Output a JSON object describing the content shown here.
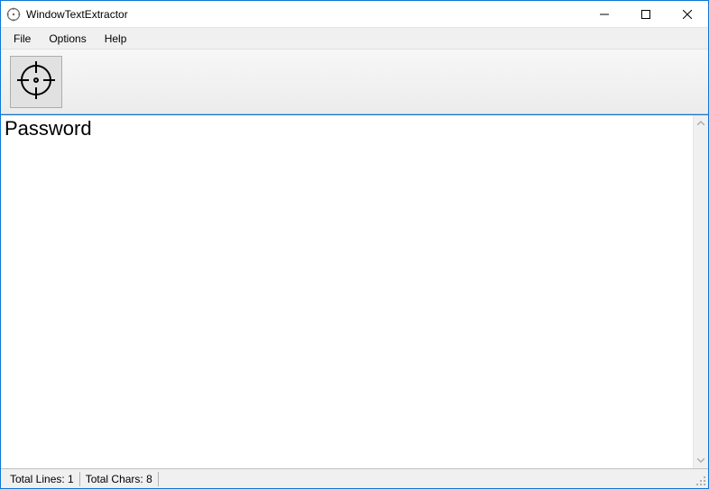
{
  "titlebar": {
    "title": "WindowTextExtractor"
  },
  "menubar": {
    "items": [
      {
        "label": "File"
      },
      {
        "label": "Options"
      },
      {
        "label": "Help"
      }
    ]
  },
  "content": {
    "text": "Password"
  },
  "statusbar": {
    "lines_label": "Total Lines:",
    "lines_value": "1",
    "chars_label": "Total Chars:",
    "chars_value": "8"
  }
}
